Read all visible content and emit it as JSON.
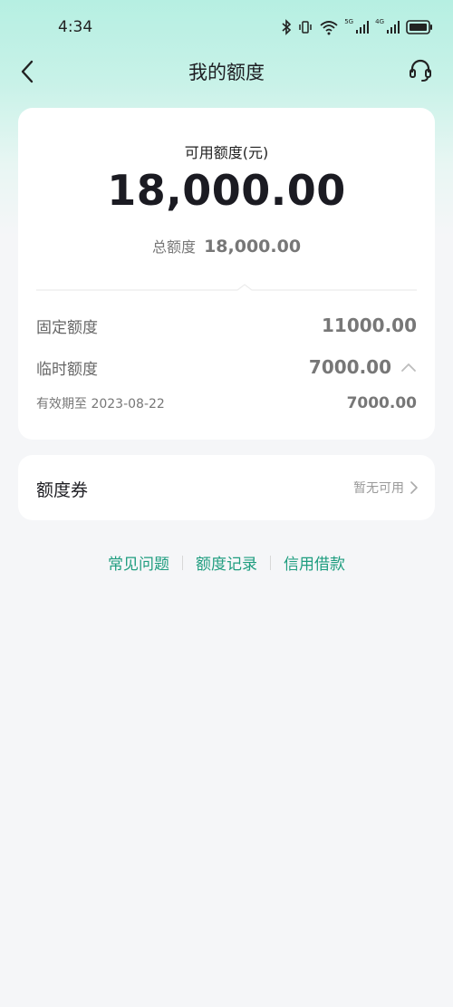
{
  "status_bar": {
    "time": "4:34",
    "net1": "5G",
    "net2": "4G"
  },
  "nav": {
    "title": "我的额度",
    "back_icon": "chevron-left-icon",
    "service_icon": "headset-icon"
  },
  "credit": {
    "available_label": "可用额度(元)",
    "available_amount": "18,000.00",
    "total_label": "总额度",
    "total_amount": "18,000.00",
    "fixed_label": "固定额度",
    "fixed_amount": "11000.00",
    "temp_label": "临时额度",
    "temp_amount": "7000.00",
    "expire_label": "有效期至 2023-08-22",
    "expire_amount": "7000.00"
  },
  "coupon": {
    "title": "额度券",
    "status": "暂无可用"
  },
  "links": {
    "faq": "常见问题",
    "records": "额度记录",
    "loan": "信用借款"
  },
  "colors": {
    "accent": "#1f9d7f",
    "header_gradient_top": "#b6efe2",
    "background": "#f5f6f8"
  }
}
